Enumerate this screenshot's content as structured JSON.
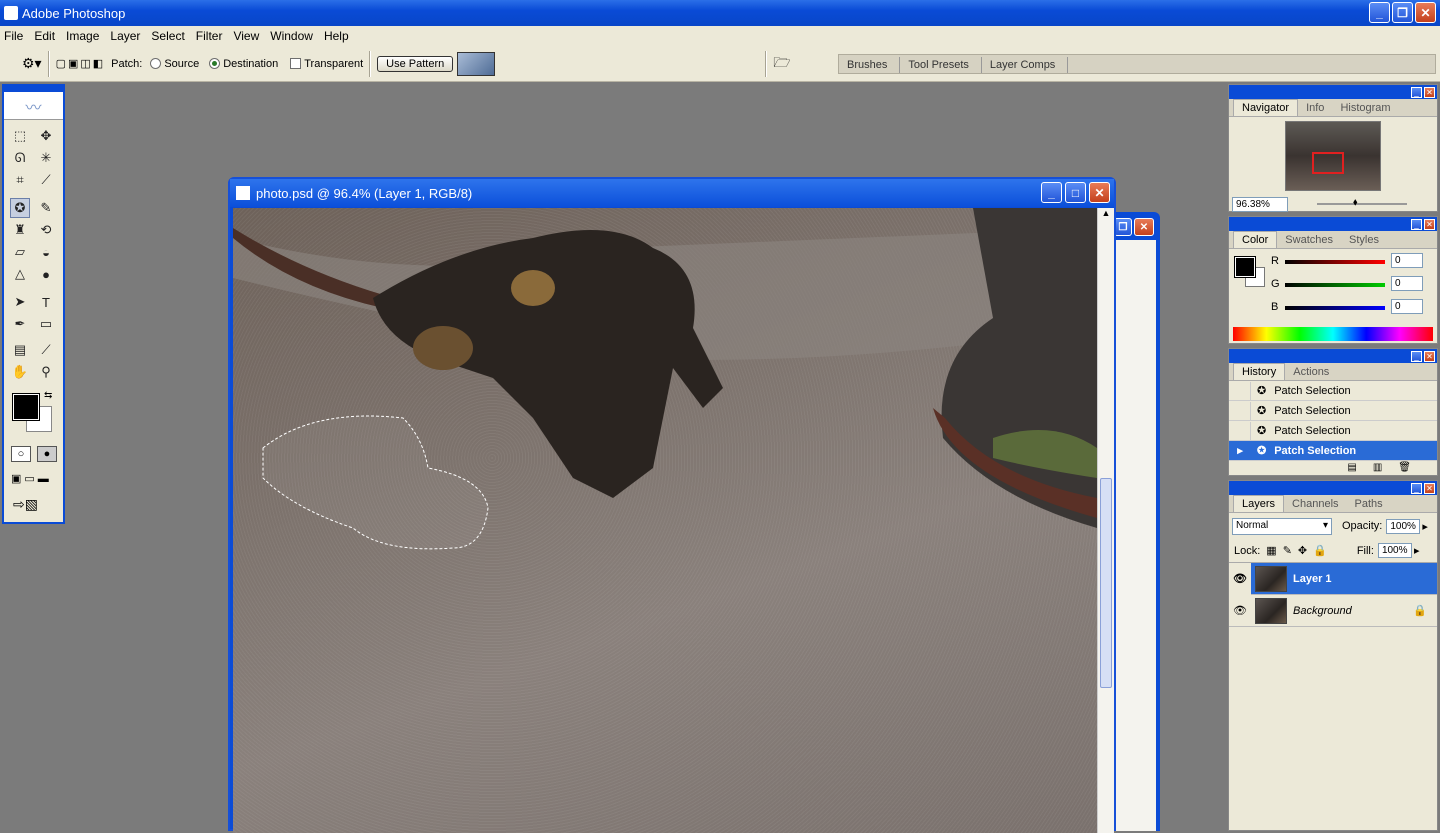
{
  "app": {
    "title": "Adobe Photoshop"
  },
  "menu": [
    "File",
    "Edit",
    "Image",
    "Layer",
    "Select",
    "Filter",
    "View",
    "Window",
    "Help"
  ],
  "options": {
    "patch_label": "Patch:",
    "source_label": "Source",
    "destination_label": "Destination",
    "transparent_label": "Transparent",
    "use_pattern_label": "Use Pattern",
    "selected_mode": "Destination"
  },
  "palette_well": [
    "Brushes",
    "Tool Presets",
    "Layer Comps"
  ],
  "document": {
    "title": "photo.psd @ 96.4% (Layer 1, RGB/8)"
  },
  "navigator": {
    "tabs": [
      "Navigator",
      "Info",
      "Histogram"
    ],
    "zoom": "96.38%"
  },
  "color": {
    "tabs": [
      "Color",
      "Swatches",
      "Styles"
    ],
    "r_label": "R",
    "g_label": "G",
    "b_label": "B",
    "r": "0",
    "g": "0",
    "b": "0"
  },
  "history": {
    "tabs": [
      "History",
      "Actions"
    ],
    "items": [
      "Patch Selection",
      "Patch Selection",
      "Patch Selection",
      "Patch Selection"
    ]
  },
  "layers": {
    "tabs": [
      "Layers",
      "Channels",
      "Paths"
    ],
    "blend_mode": "Normal",
    "opacity_label": "Opacity:",
    "opacity": "100%",
    "lock_label": "Lock:",
    "fill_label": "Fill:",
    "fill": "100%",
    "items": [
      "Layer 1",
      "Background"
    ]
  },
  "colors": {
    "accent": "#0a4bd6",
    "selection": "#2a6bd6",
    "chrome": "#ece9d8"
  }
}
